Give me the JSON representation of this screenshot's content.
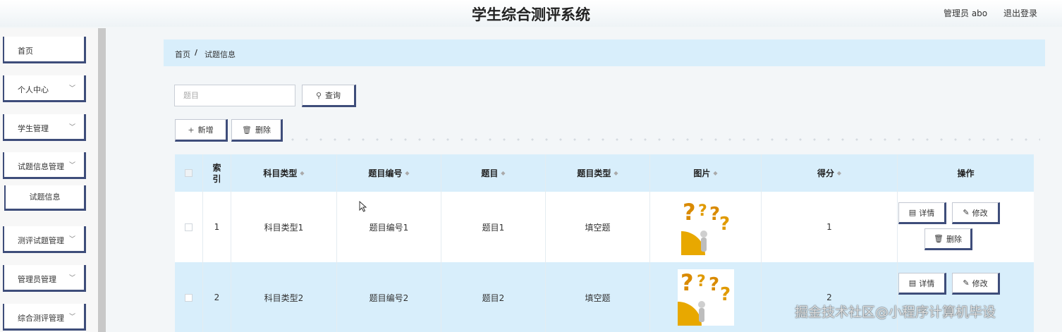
{
  "header": {
    "title": "学生综合测评系统",
    "user": "管理员 abo",
    "logout": "退出登录"
  },
  "sidebar": {
    "items": [
      {
        "label": "首页"
      },
      {
        "label": "个人中心"
      },
      {
        "label": "学生管理"
      },
      {
        "label": "试题信息管理"
      },
      {
        "label": "测评试题管理"
      },
      {
        "label": "管理员管理"
      },
      {
        "label": "综合测评管理"
      }
    ],
    "sub_item": "试题信息"
  },
  "breadcrumb": {
    "home": "首页",
    "separator": "/",
    "current": "试题信息"
  },
  "search": {
    "placeholder": "题目",
    "button": "查询"
  },
  "toolbar": {
    "add": "新增",
    "delete": "删除"
  },
  "table": {
    "columns": [
      "索引",
      "科目类型",
      "题目编号",
      "题目",
      "题目类型",
      "图片",
      "得分",
      "操作"
    ],
    "rows": [
      {
        "index": "1",
        "subject_type": "科目类型1",
        "question_no": "题目编号1",
        "question": "题目1",
        "question_type": "填空题",
        "score": "1"
      },
      {
        "index": "2",
        "subject_type": "科目类型2",
        "question_no": "题目编号2",
        "question": "题目2",
        "question_type": "填空题",
        "score": "2"
      }
    ],
    "actions": {
      "detail": "详情",
      "edit": "修改",
      "delete": "删除"
    }
  },
  "watermark": "掘金技术社区@小程序计算机毕设",
  "colors": {
    "accent": "#3e4d7a",
    "header_bg": "#d8eefb"
  }
}
